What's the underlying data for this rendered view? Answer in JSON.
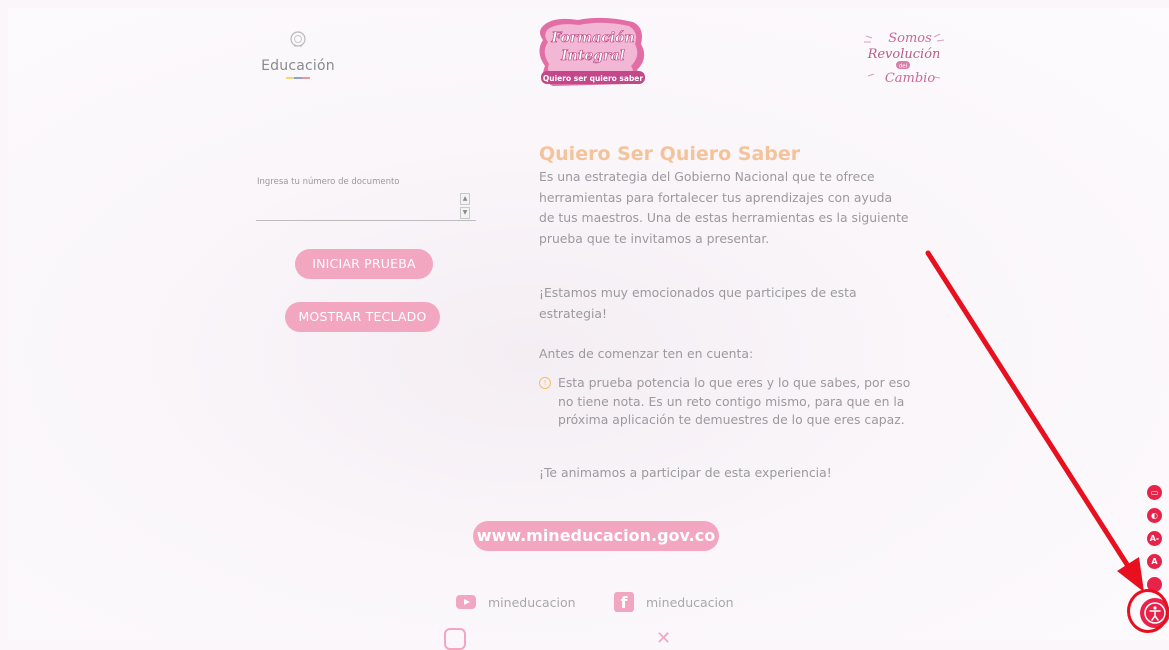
{
  "header": {
    "left_logo_text": "Educación",
    "center_logo_lines": [
      "Formación",
      "Integral",
      "Quiero ser quiero saber"
    ],
    "right_logo_lines": [
      "Somos",
      "Revolución",
      "del",
      "Cambio"
    ]
  },
  "form": {
    "document_label": "Ingresa tu número de documento",
    "document_value": "",
    "start_button": "INICIAR PRUEBA",
    "keyboard_button": "MOSTRAR TECLADO"
  },
  "content": {
    "title": "Quiero Ser Quiero Saber",
    "paragraph_1": "Es una estrategia del Gobierno Nacional que te ofrece herramientas para fortalecer tus aprendizajes con ayuda de tus maestros. Una de estas herramientas es la siguiente prueba que te invitamos a presentar.",
    "paragraph_2": "¡Estamos muy emocionados que participes de esta estrategia!",
    "paragraph_3": "Antes de comenzar ten en cuenta:",
    "bullet_1": "Esta prueba potencia lo que eres y lo que sabes, por eso no tiene nota. Es un reto contigo mismo, para que en la próxima aplicación te demuestres de lo que eres capaz.",
    "paragraph_4": "¡Te animamos a participar de esta experiencia!"
  },
  "footer": {
    "url": "www.mineducacion.gov.co",
    "youtube_label": "mineducacion",
    "facebook_label": "mineducacion"
  },
  "accessibility": {
    "buttons": [
      "keyboard-icon",
      "contrast-icon",
      "decrease-font-icon",
      "increase-font-icon",
      "accessibility-icon"
    ],
    "accent_color": "#e8234a"
  },
  "colors": {
    "pink_button": "#f3a6bf",
    "title_color": "#f4c39a",
    "annotation_red": "#e8101e"
  }
}
